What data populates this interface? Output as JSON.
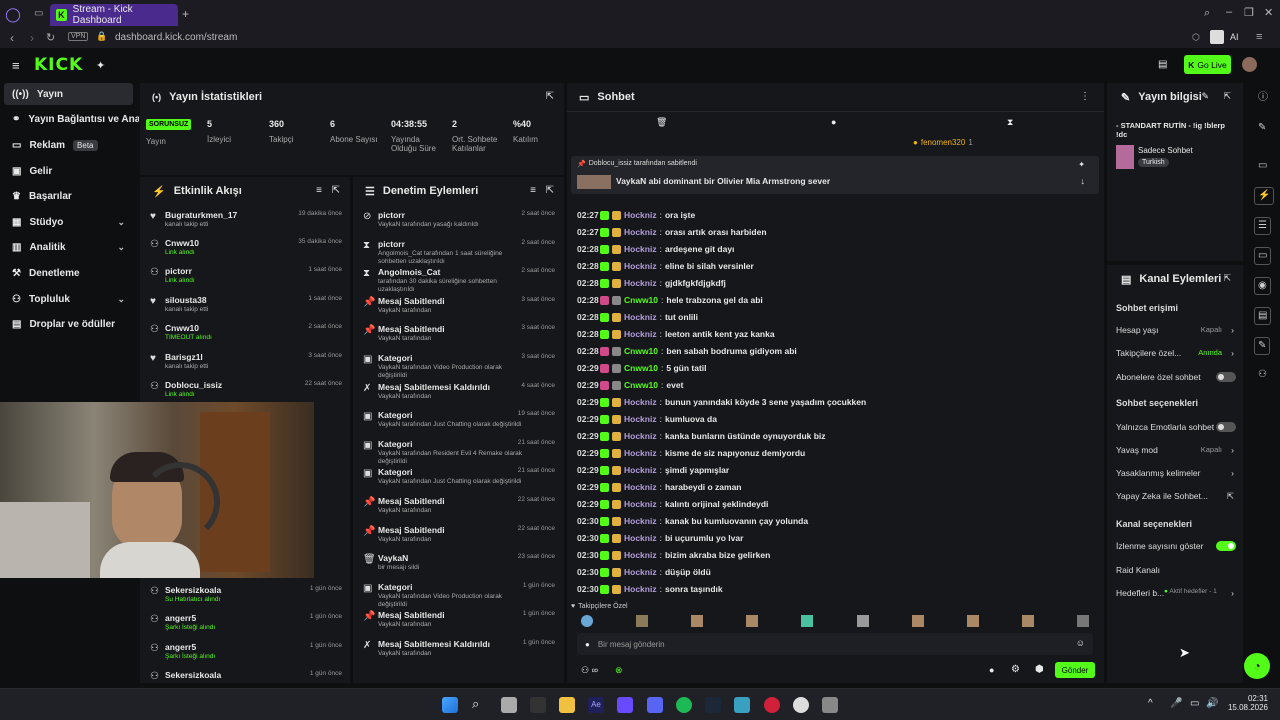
{
  "browser": {
    "tab_title": "Stream - Kick Dashboard",
    "url": "dashboard.kick.com/stream",
    "vpn": "VPN",
    "ai": "AI"
  },
  "header": {
    "logo": "KICK",
    "go_live": "Go Live"
  },
  "sidebar": {
    "items": [
      {
        "label": "Yayın"
      },
      {
        "label": "Yayın Bağlantısı ve Anahtarı"
      },
      {
        "label": "Reklam",
        "badge": "Beta"
      },
      {
        "label": "Gelir"
      },
      {
        "label": "Başarılar"
      },
      {
        "label": "Stüdyo"
      },
      {
        "label": "Analitik"
      },
      {
        "label": "Denetleme"
      },
      {
        "label": "Topluluk"
      },
      {
        "label": "Droplar ve ödüller"
      }
    ]
  },
  "stats": {
    "title": "Yayın İstatistikleri",
    "status": "SORUNSUZ",
    "status_label": "Yayın",
    "items": [
      {
        "value": "5",
        "label": "İzleyici"
      },
      {
        "value": "360",
        "label": "Takipçi"
      },
      {
        "value": "6",
        "label": "Abone Sayısı"
      },
      {
        "value": "04:38:55",
        "label": "Yayında Olduğu Süre"
      },
      {
        "value": "2",
        "label": "Ort. Sohbete Katılanlar"
      },
      {
        "value": "%40",
        "label": "Katılım"
      }
    ]
  },
  "activity": {
    "title": "Etkinlik Akışı",
    "rows": [
      {
        "name": "Bugraturkmen_17",
        "sub": "kanalı takip etti",
        "time": "19 dakika önce"
      },
      {
        "name": "Cnww10",
        "sub": "Link alındı",
        "time": "35 dakika önce"
      },
      {
        "name": "pictorr",
        "sub": "Link alındı",
        "time": "1 saat önce"
      },
      {
        "name": "silousta38",
        "sub": "kanalı takip etti",
        "time": "1 saat önce"
      },
      {
        "name": "Cnww10",
        "sub": "TIMEOUT alındı",
        "time": "2 saat önce"
      },
      {
        "name": "Barisgz1l",
        "sub": "kanalı takip etti",
        "time": "3 saat önce"
      },
      {
        "name": "Doblocu_issiz",
        "sub": "Link alındı",
        "time": "22 saat önce"
      },
      {
        "name": "Sekersizkoala",
        "sub": "Su Hatırlatıcı alındı",
        "time": "1 gün önce"
      },
      {
        "name": "angerr5",
        "sub": "Şarkı İsteği alındı",
        "time": "1 gün önce"
      },
      {
        "name": "angerr5",
        "sub": "Şarkı İsteği alındı",
        "time": "1 gün önce"
      },
      {
        "name": "Sekersizkoala",
        "sub": "",
        "time": "1 gün önce"
      }
    ]
  },
  "moderation": {
    "title": "Denetim Eylemleri",
    "rows": [
      {
        "name": "pictorr",
        "sub": "VaykaN tarafından yasağı kaldırıldı",
        "time": "2 saat önce"
      },
      {
        "name": "pictorr",
        "sub": "Angolmois_Cat tarafından 1 saat süreliğine sohbetten uzaklaştırıldı",
        "time": "2 saat önce"
      },
      {
        "name": "Angolmois_Cat",
        "sub": "tarafından 30 dakika süreliğine sohbetten uzaklaştırıldı",
        "time": "2 saat önce"
      },
      {
        "name": "Mesaj Sabitlendi",
        "sub": "VaykaN tarafından",
        "time": "3 saat önce"
      },
      {
        "name": "Mesaj Sabitlendi",
        "sub": "VaykaN tarafından",
        "time": "3 saat önce"
      },
      {
        "name": "Kategori",
        "sub": "VaykaN tarafından Video Production olarak değiştirildi",
        "time": "3 saat önce"
      },
      {
        "name": "Mesaj Sabitlemesi Kaldırıldı",
        "sub": "VaykaN tarafından",
        "time": "4 saat önce"
      },
      {
        "name": "Kategori",
        "sub": "VaykaN tarafından Just Chatting olarak değiştirildi",
        "time": "19 saat önce"
      },
      {
        "name": "Kategori",
        "sub": "VaykaN tarafından Resident Evil 4 Remake olarak değiştirildi",
        "time": "21 saat önce"
      },
      {
        "name": "Kategori",
        "sub": "VaykaN tarafından Just Chatting olarak değiştirildi",
        "time": "21 saat önce"
      },
      {
        "name": "Mesaj Sabitlendi",
        "sub": "VaykaN tarafından",
        "time": "22 saat önce"
      },
      {
        "name": "Mesaj Sabitlendi",
        "sub": "VaykaN tarafından",
        "time": "22 saat önce"
      },
      {
        "name": "VaykaN",
        "sub": "bir mesajı sildi",
        "time": "23 saat önce"
      },
      {
        "name": "Kategori",
        "sub": "VaykaN tarafından Video Production olarak değiştirildi",
        "time": "1 gün önce"
      },
      {
        "name": "Mesaj Sabitlendi",
        "sub": "VaykaN tarafından",
        "time": "1 gün önce"
      },
      {
        "name": "Mesaj Sabitlemesi Kaldırıldı",
        "sub": "VaykaN tarafından",
        "time": "1 gün önce"
      }
    ]
  },
  "chat": {
    "title": "Sohbet",
    "top_user": "fenomen320",
    "top_user_count": "1",
    "pinned_by": "Doblocu_issiz tarafından sabitlendi",
    "pinned_msg": "VaykaN abi dominant bir Olivier Mia Armstrong sever",
    "messages": [
      {
        "t": "02:27",
        "u": "Hockniz",
        "m": "ora işte"
      },
      {
        "t": "02:27",
        "u": "Hockniz",
        "m": "orası artık orası harbiden"
      },
      {
        "t": "02:28",
        "u": "Hockniz",
        "m": "ardeşene git dayı"
      },
      {
        "t": "02:28",
        "u": "Hockniz",
        "m": "eline bi silah versinler"
      },
      {
        "t": "02:28",
        "u": "Hockniz",
        "m": "gjdkfgkfdjgkdfj"
      },
      {
        "t": "02:28",
        "u": "Cnww10",
        "m": "hele trabzona gel da abi"
      },
      {
        "t": "02:28",
        "u": "Hockniz",
        "m": "tut onlili"
      },
      {
        "t": "02:28",
        "u": "Hockniz",
        "m": "leeton antik kent yaz kanka"
      },
      {
        "t": "02:28",
        "u": "Cnww10",
        "m": "ben sabah bodruma gidiyom abi"
      },
      {
        "t": "02:29",
        "u": "Cnww10",
        "m": "5 gün tatil"
      },
      {
        "t": "02:29",
        "u": "Cnww10",
        "m": "evet"
      },
      {
        "t": "02:29",
        "u": "Hockniz",
        "m": "bunun yanındaki köyde 3 sene yaşadım çocukken"
      },
      {
        "t": "02:29",
        "u": "Hockniz",
        "m": "kumluova da"
      },
      {
        "t": "02:29",
        "u": "Hockniz",
        "m": "kanka bunların üstünde oynuyorduk biz"
      },
      {
        "t": "02:29",
        "u": "Hockniz",
        "m": "kisme de siz napıyonuz demiyordu"
      },
      {
        "t": "02:29",
        "u": "Hockniz",
        "m": "şimdi yapmışlar"
      },
      {
        "t": "02:29",
        "u": "Hockniz",
        "m": "harabeydi o zaman"
      },
      {
        "t": "02:29",
        "u": "Hockniz",
        "m": "kalıntı orijinal şeklindeydi"
      },
      {
        "t": "02:30",
        "u": "Hockniz",
        "m": "kanak bu kumluovanın çay yolunda"
      },
      {
        "t": "02:30",
        "u": "Hockniz",
        "m": "bi uçurumlu yo lvar"
      },
      {
        "t": "02:30",
        "u": "Hockniz",
        "m": "bizim akraba bize gelirken"
      },
      {
        "t": "02:30",
        "u": "Hockniz",
        "m": "düşüp öldü"
      },
      {
        "t": "02:30",
        "u": "Hockniz",
        "m": "sonra taşındık"
      }
    ],
    "followers_only": "Takipçilere Özel",
    "input_placeholder": "Bir mesaj gönderin",
    "send": "Gönder"
  },
  "stream_info": {
    "title": "Yayın bilgisi",
    "stream_title": "- STANDART RUTİN - !ig !blerp !dc",
    "category": "Sadece Sohbet",
    "language": "Turkish"
  },
  "channel_actions": {
    "title": "Kanal Eylemleri",
    "chat_access": "Sohbet erişimi",
    "account_age": "Hesap yaşı",
    "account_age_value": "Kapalı",
    "followers_only": "Takipçilere özel...",
    "followers_only_value": "Anında",
    "subs_only": "Abonelere özel sohbet",
    "chat_options": "Sohbet seçenekleri",
    "emotes_only": "Yalnızca Emotlarla sohbet",
    "slow_mode": "Yavaş mod",
    "slow_mode_value": "Kapalı",
    "banned_words": "Yasaklanmış kelimeler",
    "ai_chat": "Yapay Zeka ile Sohbet...",
    "channel_options": "Kanal seçenekleri",
    "show_viewers": "İzlenme sayısını göster",
    "raid": "Raid Kanalı",
    "goals": "Hedefleri b...",
    "goals_value": "Aktif hedefler - 1"
  },
  "taskbar": {
    "time": "02:31",
    "date": "15.08.2026"
  },
  "colors": {
    "accent": "#53fc18",
    "bg": "#0e0f11",
    "panel": "#16171b"
  }
}
